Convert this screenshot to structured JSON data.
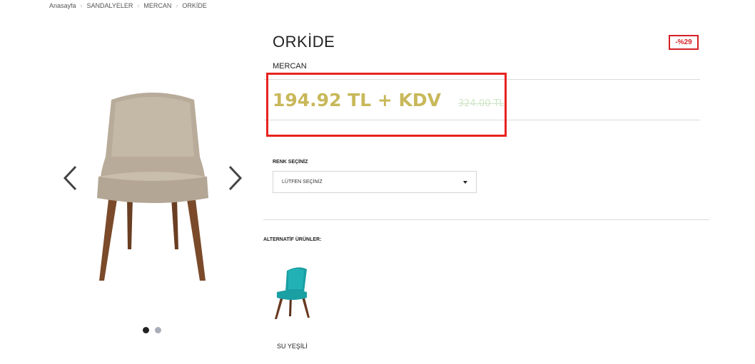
{
  "breadcrumb": [
    "Anasayfa",
    "SANDALYELER",
    "MERCAN",
    "ORKİDE"
  ],
  "product": {
    "title": "ORKİDE",
    "brand": "MERCAN",
    "discount_badge": "-%29",
    "price": "194.92 TL + KDV",
    "old_price": "324.00 TL"
  },
  "options": {
    "color_label": "RENK SEÇİNİZ",
    "color_selected": "LÜTFEN SEÇİNİZ"
  },
  "alternatives": {
    "label": "ALTERNATİF ÜRÜNLER:",
    "items": [
      {
        "name": "SU YEŞİLİ"
      }
    ]
  },
  "gallery": {
    "slide_count": 2,
    "active_slide": 1
  },
  "colors": {
    "accent_price": "#c8b85a",
    "discount_red": "#d61f26",
    "highlight_red": "#e8231f",
    "old_price": "#cfe6c7"
  }
}
